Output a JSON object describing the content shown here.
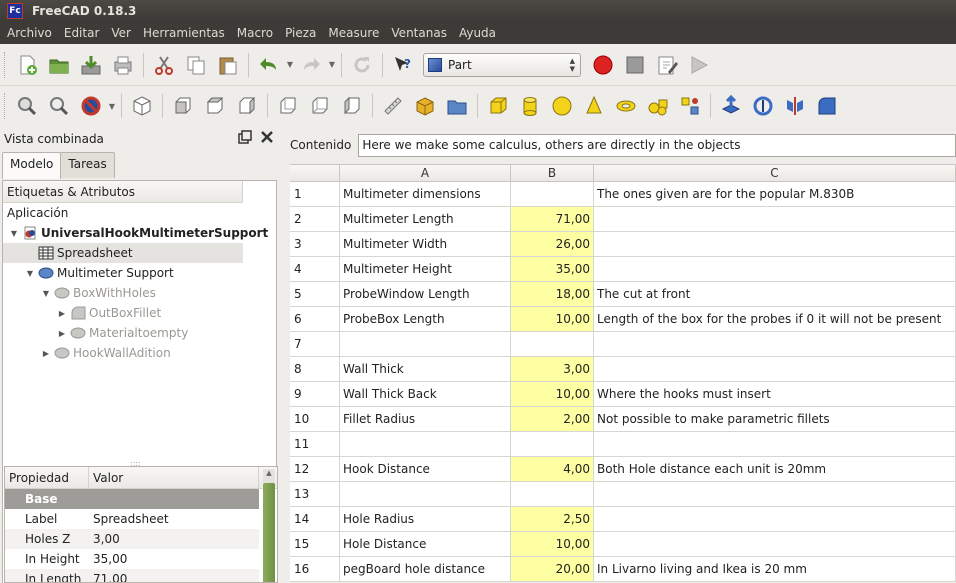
{
  "window": {
    "title": "FreeCAD 0.18.3",
    "logo": "Fc"
  },
  "menu": [
    "Archivo",
    "Editar",
    "Ver",
    "Herramientas",
    "Macro",
    "Pieza",
    "Measure",
    "Ventanas",
    "Ayuda"
  ],
  "toolbar": {
    "workbench": "Part"
  },
  "combo": {
    "title": "Vista combinada",
    "tabs": [
      "Modelo",
      "Tareas"
    ],
    "tree_header": "Etiquetas & Atributos",
    "tree_root": "Aplicación",
    "tree": [
      {
        "label": "UniversalHookMultimeterSupport"
      },
      {
        "label": "Spreadsheet"
      },
      {
        "label": "Multimeter Support"
      },
      {
        "label": "BoxWithHoles"
      },
      {
        "label": "OutBoxFillet"
      },
      {
        "label": "Materialtoempty"
      },
      {
        "label": "HookWallAdition"
      }
    ],
    "props": {
      "headers": [
        "Propiedad",
        "Valor"
      ],
      "group": "Base",
      "rows": [
        {
          "k": "Label",
          "v": "Spreadsheet"
        },
        {
          "k": "Holes Z",
          "v": "3,00"
        },
        {
          "k": "In Height",
          "v": "35,00"
        },
        {
          "k": "In Length",
          "v": "71,00"
        }
      ]
    }
  },
  "sheet": {
    "content_label": "Contenido",
    "content_value": "Here we make some calculus, others are directly in the objects",
    "columns": [
      "A",
      "B",
      "C"
    ],
    "rows": [
      {
        "n": "1",
        "a": "Multimeter dimensions",
        "b": "",
        "c": "The ones given are for the popular M.830B"
      },
      {
        "n": "2",
        "a": "Multimeter Length",
        "b": "71,00",
        "c": ""
      },
      {
        "n": "3",
        "a": "Multimeter Width",
        "b": "26,00",
        "c": ""
      },
      {
        "n": "4",
        "a": "Multimeter Height",
        "b": "35,00",
        "c": ""
      },
      {
        "n": "5",
        "a": "ProbeWindow Length",
        "b": "18,00",
        "c": "The cut at front"
      },
      {
        "n": "6",
        "a": "ProbeBox Length",
        "b": "10,00",
        "c": "Length of the box for the probes if 0 it will not be present"
      },
      {
        "n": "7",
        "a": "",
        "b": "",
        "c": ""
      },
      {
        "n": "8",
        "a": "Wall Thick",
        "b": "3,00",
        "c": ""
      },
      {
        "n": "9",
        "a": "Wall Thick Back",
        "b": "10,00",
        "c": "Where the hooks must insert"
      },
      {
        "n": "10",
        "a": "Fillet Radius",
        "b": "2,00",
        "c": "Not possible to make parametric fillets"
      },
      {
        "n": "11",
        "a": "",
        "b": "",
        "c": ""
      },
      {
        "n": "12",
        "a": "Hook Distance",
        "b": "4,00",
        "c": "Both Hole distance each unit is 20mm"
      },
      {
        "n": "13",
        "a": "",
        "b": "",
        "c": ""
      },
      {
        "n": "14",
        "a": "Hole Radius",
        "b": "2,50",
        "c": ""
      },
      {
        "n": "15",
        "a": "Hole Distance",
        "b": "10,00",
        "c": ""
      },
      {
        "n": "16",
        "a": "pegBoard hole distance",
        "b": "20,00",
        "c": "In Livarno living and Ikea is 20 mm"
      }
    ]
  }
}
